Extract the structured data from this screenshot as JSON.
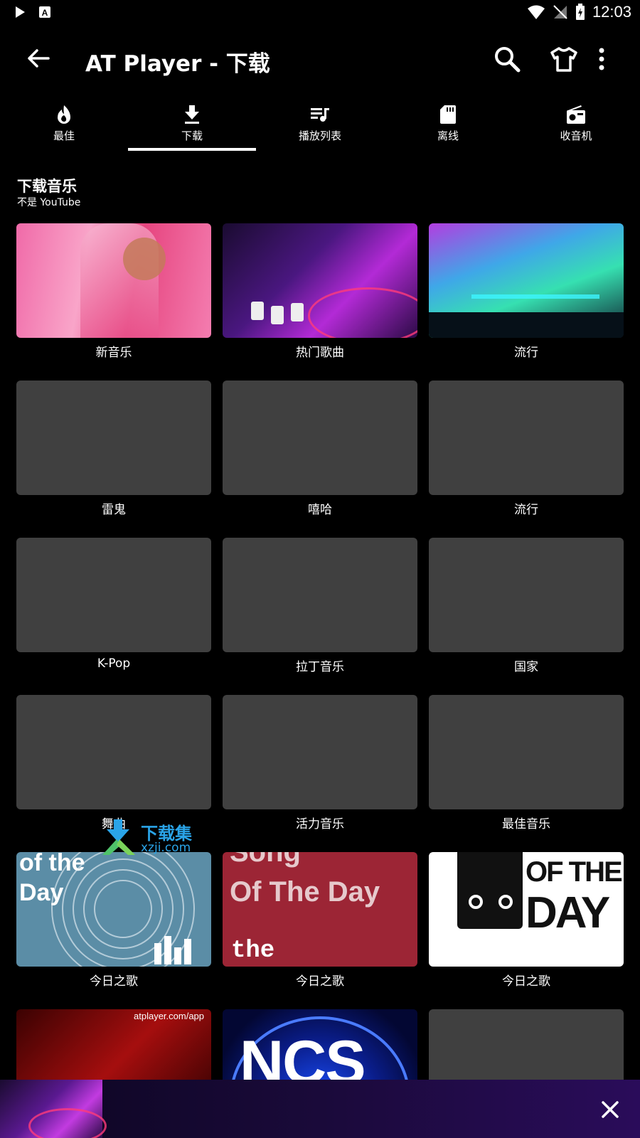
{
  "status_bar": {
    "time": "12:03"
  },
  "app_bar": {
    "title": "AT Player - 下载"
  },
  "tabs": [
    {
      "label": "最佳",
      "icon": "flame-icon"
    },
    {
      "label": "下载",
      "icon": "download-icon",
      "selected": true
    },
    {
      "label": "播放列表",
      "icon": "playlist-icon"
    },
    {
      "label": "离线",
      "icon": "sd-card-icon"
    },
    {
      "label": "收音机",
      "icon": "radio-icon"
    }
  ],
  "section": {
    "title": "下载音乐",
    "subtitle": "不是 YouTube"
  },
  "tiles": [
    {
      "label": "新音乐"
    },
    {
      "label": "热门歌曲"
    },
    {
      "label": "流行"
    },
    {
      "label": "雷鬼"
    },
    {
      "label": "嘻哈"
    },
    {
      "label": "流行"
    },
    {
      "label": "K-Pop"
    },
    {
      "label": "拉丁音乐"
    },
    {
      "label": "国家"
    },
    {
      "label": "舞曲"
    },
    {
      "label": "活力音乐"
    },
    {
      "label": "最佳音乐"
    },
    {
      "label": "今日之歌",
      "art_text": [
        "of the",
        "Day"
      ]
    },
    {
      "label": "今日之歌",
      "art_text": [
        "Song",
        "Of The Day",
        "the"
      ]
    },
    {
      "label": "今日之歌",
      "art_text": [
        "OF THE",
        "DAY"
      ]
    },
    {
      "label": "",
      "art_text": [
        "atplayer.com/app"
      ]
    },
    {
      "label": "",
      "art_text": [
        "NCS"
      ]
    },
    {
      "label": ""
    }
  ],
  "watermark": {
    "brand": "下载集",
    "domain": "xzji.com"
  },
  "colors": {
    "background": "#000000",
    "placeholder": "#404040",
    "accent": "#ffffff"
  }
}
